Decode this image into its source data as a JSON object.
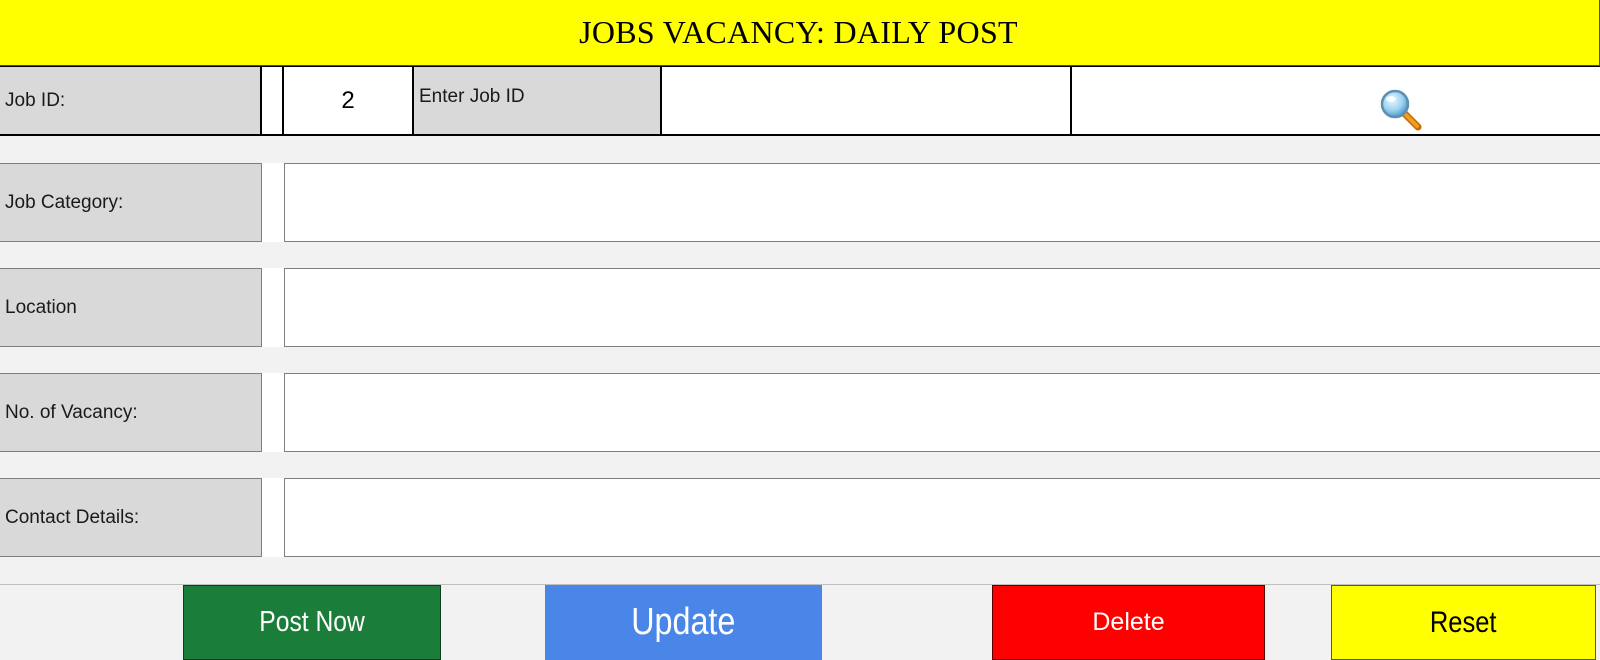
{
  "header": {
    "title": "JOBS VACANCY: DAILY POST"
  },
  "job_id_row": {
    "label": "Job ID:",
    "value": "2",
    "prompt": "Enter Job ID",
    "input_value": "",
    "search_icon": "search-icon"
  },
  "form": {
    "rows": [
      {
        "label": "Job Category:",
        "value": ""
      },
      {
        "label": "Location",
        "value": ""
      },
      {
        "label": "No. of Vacancy:",
        "value": ""
      },
      {
        "label": "Contact Details:",
        "value": ""
      }
    ]
  },
  "buttons": {
    "post": "Post Now",
    "update": "Update",
    "delete": "Delete",
    "reset": "Reset"
  },
  "colors": {
    "header_bg": "#ffff00",
    "post": "#1b7d3a",
    "update": "#4a86e8",
    "delete": "#ff0000",
    "reset": "#ffff00",
    "label_bg": "#d9d9d9"
  }
}
